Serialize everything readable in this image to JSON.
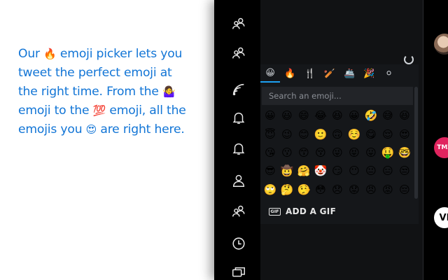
{
  "promo": {
    "line1_a": "Our ",
    "line1_emoji": "🔥",
    "line1_b": " emoji picker lets you",
    "line2": "tweet the perfect emoji at",
    "line3_a": "the right time. From the ",
    "line3_emoji": "🤷‍♀️",
    "line4_a": "emoji to the ",
    "line4_emoji": "💯",
    "line4_b": " emoji, all the",
    "line5_a": "emojis you ",
    "line5_emoji": "😍",
    "line5_b": " are right here."
  },
  "colors": {
    "promo_text": "#1275d6",
    "app_bg": "#000000",
    "picker_bg": "#15171a",
    "accent": "#1da1f2"
  },
  "rail": {
    "icons": [
      "users-icon",
      "users-icon",
      "feed-icon",
      "bell-icon",
      "bell-icon",
      "user-icon",
      "users-icon",
      "clock-icon",
      "messages-icon"
    ]
  },
  "picker": {
    "category_tabs": [
      "😀",
      "🔥",
      "🍴",
      "🏏",
      "🚢",
      "🎉",
      "⚪"
    ],
    "search_placeholder": "Search an emoji...",
    "emojis": [
      "😀",
      "😃",
      "😄",
      "😂",
      "😆",
      "😀",
      "🤣",
      "😅",
      "😆",
      "😇",
      "😉",
      "😊",
      "🙂",
      "🙃",
      "☺️",
      "😋",
      "😌",
      "😍",
      "😘",
      "😗",
      "😙",
      "😚",
      "😜",
      "😝",
      "😛",
      "🤑",
      "🤓",
      "😎",
      "🤠",
      "🤗",
      "🤡",
      "😏",
      "😶",
      "😐",
      "😑",
      "😒",
      "🙄",
      "🤔",
      "🤥",
      "😳",
      "😞",
      "😟",
      "😠",
      "😡",
      "😔"
    ],
    "gif_badge": "GIF",
    "gif_label": "ADD A GIF"
  },
  "avatars": {
    "second_label": "TMZ",
    "third_label": "VI"
  }
}
